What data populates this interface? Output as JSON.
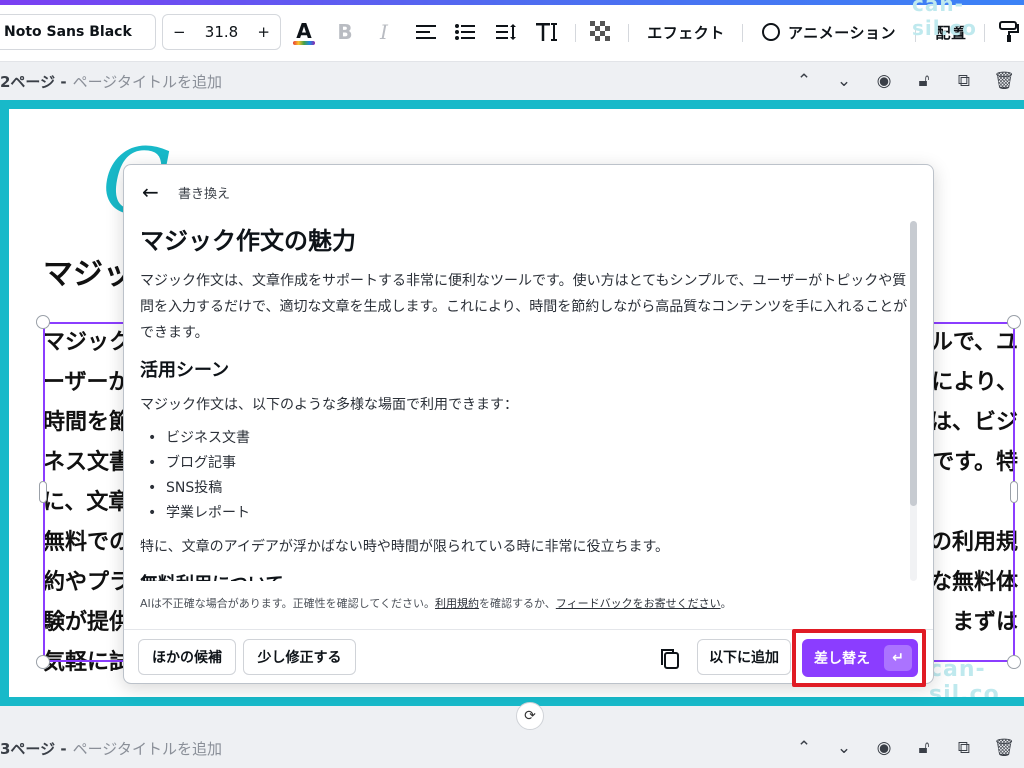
{
  "toolbar": {
    "font_name": "Noto Sans Black",
    "minus": "−",
    "font_size": "31.8",
    "plus": "+",
    "text_color_glyph": "A",
    "bold_glyph": "B",
    "italic_glyph": "I",
    "effects_label": "エフェクト",
    "animation_label": "アニメーション",
    "position_label": "配置",
    "watermark": "can-sil.co"
  },
  "page2": {
    "number": "2ページ -",
    "title_placeholder": "ページタイトルを追加"
  },
  "page3": {
    "number": "3ページ -",
    "title_placeholder": "ページタイトルを追加"
  },
  "canvas": {
    "deco_letter": "C",
    "heading_fragment": "マジッ",
    "body_lines": [
      {
        "left": "マジック",
        "right": "ルで、ユ"
      },
      {
        "left": "ーザーが",
        "right": "により、"
      },
      {
        "left": "時間を節",
        "right": "は、ビジ"
      },
      {
        "left": "ネス文書",
        "right": "です。特"
      },
      {
        "left": "に、文章",
        "right": ""
      },
      {
        "left": "無料での",
        "right": "の利用規"
      },
      {
        "left": "約やプラ",
        "right": "な無料体"
      },
      {
        "left": "験が提供",
        "right": "まずは"
      },
      {
        "left": "気軽に試",
        "right": ""
      }
    ],
    "watermark": "can-sil.co"
  },
  "panel": {
    "breadcrumb": "書き換え",
    "title": "マジック作文の魅力",
    "intro": "マジック作文は、文章作成をサポートする非常に便利なツールです。使い方はとてもシンプルで、ユーザーがトピックや質問を入力するだけで、適切な文章を生成します。これにより、時間を節約しながら高品質なコンテンツを手に入れることができます。",
    "section1_title": "活用シーン",
    "section1_text": "マジック作文は、以下のような多様な場面で利用できます：",
    "uses": [
      "ビジネス文書",
      "ブログ記事",
      "SNS投稿",
      "学業レポート"
    ],
    "section1_outro": "特に、文章のアイデアが浮かばない時や時間が限られている時に非常に役立ちます。",
    "section2_title": "無料利用について",
    "disclaimer_pre": "AIは不正確な場合があります。正確性を確認してください。",
    "disclaimer_link1": "利用規約",
    "disclaimer_mid": "を確認するか、",
    "disclaimer_link2": "フィードバックをお寄せください",
    "disclaimer_end": "。",
    "other_candidates": "ほかの候補",
    "tweak": "少し修正する",
    "add_below": "以下に追加",
    "replace": "差し替え",
    "enter_glyph": "↵"
  },
  "colors": {
    "accent": "#8b3dff",
    "frame": "#18b9c9",
    "highlight": "#e01b24"
  }
}
